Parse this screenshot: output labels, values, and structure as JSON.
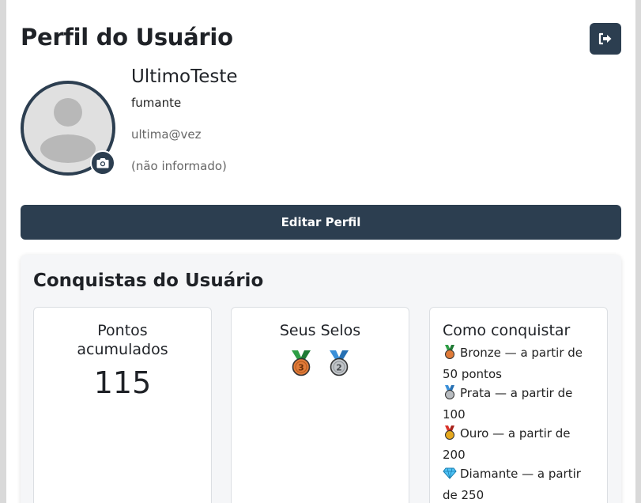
{
  "header": {
    "title": "Perfil do Usuário"
  },
  "profile": {
    "name": "UltimoTeste",
    "type": "fumante",
    "email": "ultima@vez",
    "extra": "(não informado)"
  },
  "actions": {
    "edit_label": "Editar Perfil"
  },
  "achievements": {
    "title": "Conquistas do Usuário",
    "points": {
      "label": "Pontos acumulados",
      "value": "115"
    },
    "seals": {
      "label": "Seus Selos",
      "badges": [
        "medal-bronze-3",
        "medal-silver-2"
      ]
    },
    "how_to": {
      "label": "Como conquistar",
      "items": [
        "Bronze — a partir de 50 pontos",
        "Prata — a partir de 100",
        "Ouro — a partir de 200",
        "Diamante — a partir de 250"
      ]
    }
  },
  "colors": {
    "primary": "#2c3e50",
    "bronze": "#e07b39",
    "silver": "#9ea3a8",
    "gold": "#e6a91f",
    "diamond": "#4fc3f7",
    "ribbon_green": "#2e9e45",
    "ribbon_blue": "#3a8fd8"
  }
}
